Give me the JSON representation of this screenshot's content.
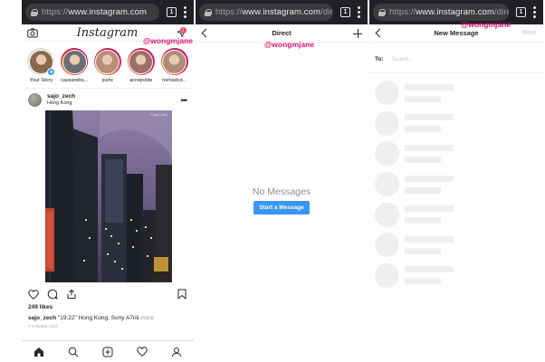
{
  "panels": [
    {
      "url_prefix": "https://",
      "url_host": "www.instagram.com",
      "url_rest": "",
      "tab_count": "1"
    },
    {
      "url_prefix": "https://",
      "url_host": "www.instagram.com",
      "url_rest": "/direct/in",
      "tab_count": "1"
    },
    {
      "url_prefix": "https://",
      "url_host": "www.instagram.com",
      "url_rest": "/direct/n",
      "tab_count": "1"
    }
  ],
  "watermark": "@wongmjane",
  "feed": {
    "logo": "Instagram",
    "notification_badge": "1",
    "stories": [
      {
        "name": "Your Story",
        "own": true,
        "color": "#8a6a4b"
      },
      {
        "name": "cassandra...",
        "own": false,
        "color": "#6d6f74"
      },
      {
        "name": "joshc",
        "own": false,
        "color": "#b98d77"
      },
      {
        "name": "acnepolite",
        "own": false,
        "color": "#9a6f6a"
      },
      {
        "name": "nomadcd...",
        "own": false,
        "color": "#b08b7a"
      }
    ],
    "post": {
      "username": "sajo_zech",
      "location": "Hong Kong",
      "photo_credit": "© sajo_zech",
      "likes": "249 likes",
      "caption_user": "sajo_zech",
      "caption_text": "\"19:22\" Hong Kong. Sony A7riii",
      "caption_more": "more",
      "time": "7 HOURS AGO"
    }
  },
  "direct": {
    "title": "Direct",
    "empty_title": "No Messages",
    "start_button": "Start a Message"
  },
  "new_message": {
    "title": "New Message",
    "next": "Next",
    "to_label": "To:",
    "search_placeholder": "Search...",
    "placeholder_rows": 7
  },
  "colors": {
    "accent": "#3897f0",
    "watermark": "#e4136f",
    "browser_chrome": "#202124"
  }
}
